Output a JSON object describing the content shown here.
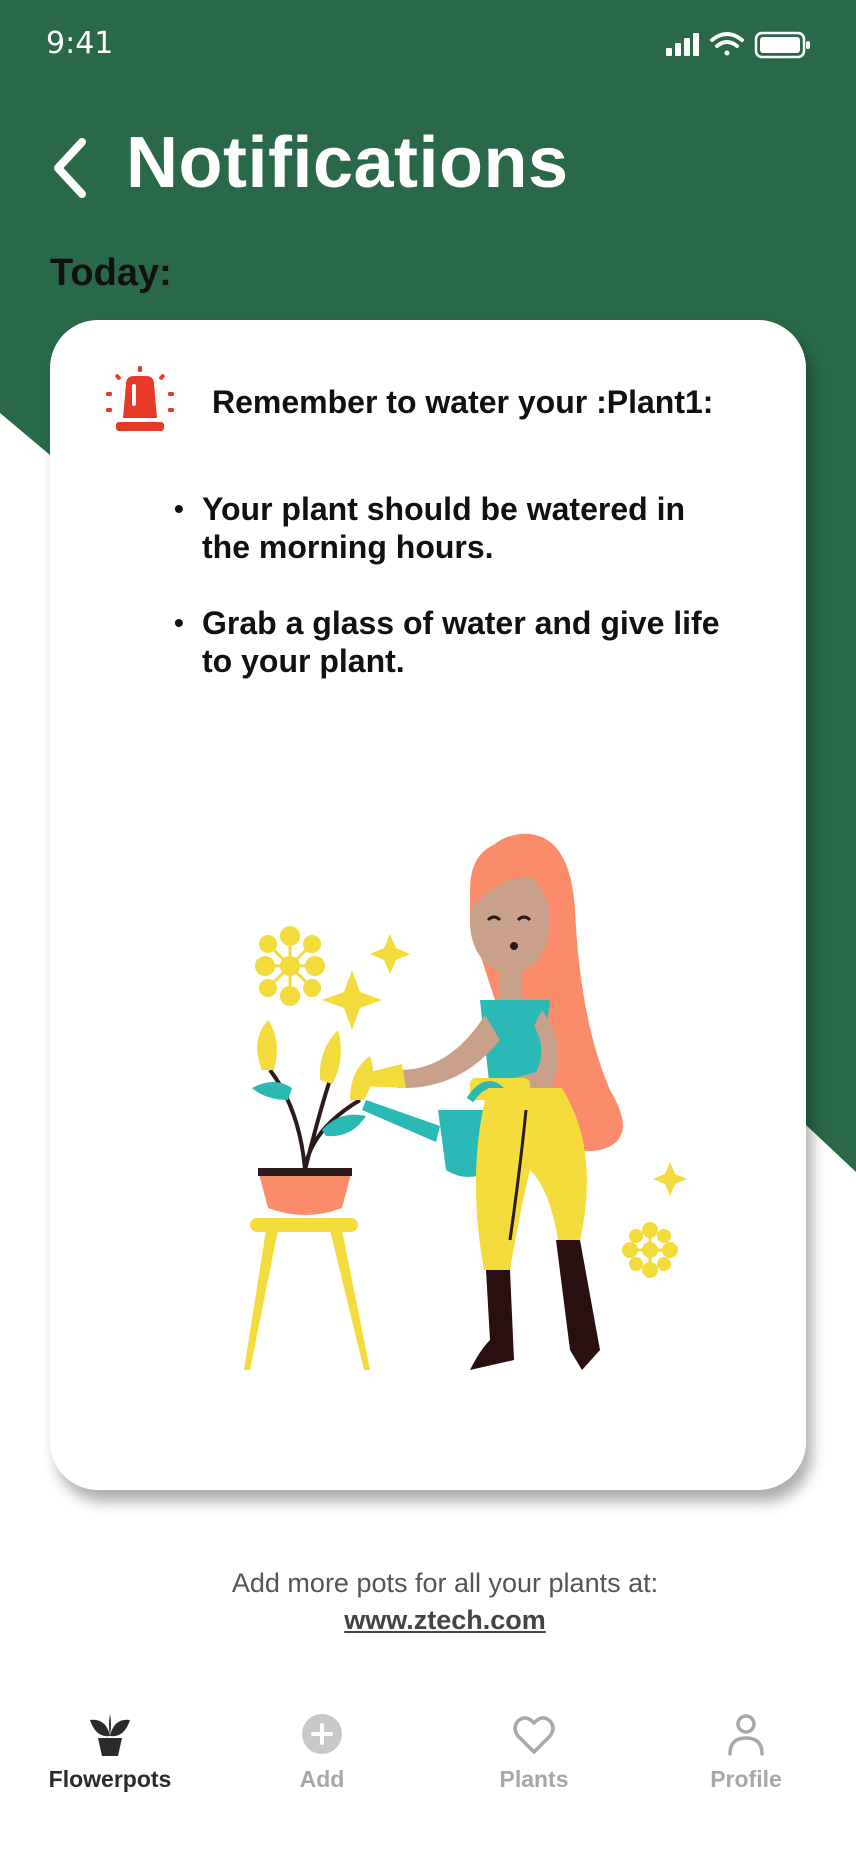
{
  "colors": {
    "brand_green": "#29694A",
    "alert_red": "#E63A26",
    "tab_active": "#2B2B2B",
    "tab_inactive": "#A8A8A8"
  },
  "status_bar": {
    "time": "9:41",
    "icons": [
      "signal-icon",
      "wifi-icon",
      "battery-icon"
    ]
  },
  "header": {
    "back_icon": "chevron-left-icon",
    "title": "Notifications"
  },
  "section": {
    "label": "Today:"
  },
  "notification": {
    "icon": "alarm-siren-icon",
    "title": "Remember to water your :Plant1:",
    "tips": [
      "Your plant should be watered in the morning hours.",
      "Grab a glass of water and give life to your plant."
    ],
    "bullet": "•",
    "illustration": "woman-watering-plant-illustration"
  },
  "promo": {
    "text": "Add more pots for all your plants at:",
    "link": "www.ztech.com"
  },
  "tab_bar": {
    "active": "flowerpots",
    "items": [
      {
        "id": "flowerpots",
        "label": "Flowerpots",
        "icon": "flowerpot-icon"
      },
      {
        "id": "add",
        "label": "Add",
        "icon": "add-circle-icon"
      },
      {
        "id": "plants",
        "label": "Plants",
        "icon": "heart-icon"
      },
      {
        "id": "profile",
        "label": "Profile",
        "icon": "person-icon"
      }
    ]
  }
}
